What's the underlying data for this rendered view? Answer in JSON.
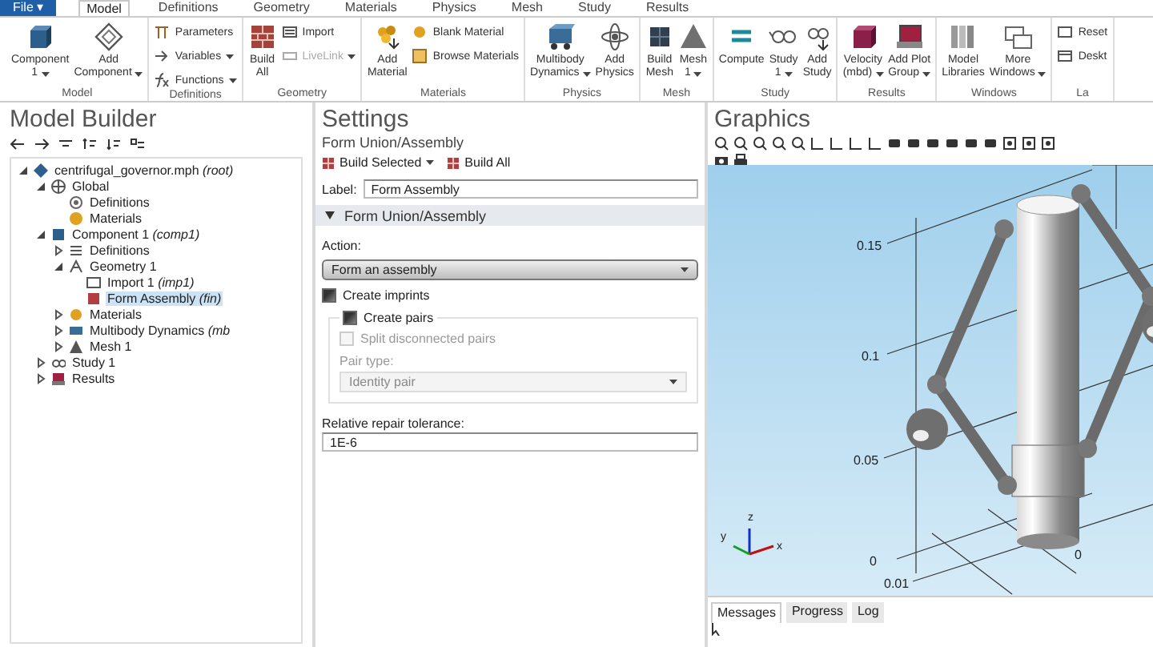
{
  "menu_tabs": [
    {
      "label": "File ▾",
      "kind": "file",
      "selected": false
    },
    {
      "label": "Model",
      "kind": "tab",
      "selected": true
    },
    {
      "label": "Definitions",
      "kind": "tab",
      "selected": false
    },
    {
      "label": "Geometry",
      "kind": "tab",
      "selected": false
    },
    {
      "label": "Materials",
      "kind": "tab",
      "selected": false
    },
    {
      "label": "Physics",
      "kind": "tab",
      "selected": false
    },
    {
      "label": "Mesh",
      "kind": "tab",
      "selected": false
    },
    {
      "label": "Study",
      "kind": "tab",
      "selected": false
    },
    {
      "label": "Results",
      "kind": "tab",
      "selected": false
    }
  ],
  "ribbon": {
    "groups": [
      {
        "label": "Model",
        "items": [
          {
            "kind": "large",
            "lines": [
              "Component",
              "1"
            ],
            "dropdown": true,
            "disabled": false
          },
          {
            "kind": "large",
            "lines": [
              "Add",
              "Component"
            ],
            "dropdown": true,
            "disabled": false
          }
        ]
      },
      {
        "label": "Definitions",
        "items": [
          {
            "kind": "small",
            "lines": [
              "Parameters"
            ],
            "dropdown": false,
            "disabled": false
          },
          {
            "kind": "small",
            "lines": [
              "Variables"
            ],
            "dropdown": true,
            "disabled": false
          },
          {
            "kind": "small",
            "lines": [
              "Functions"
            ],
            "dropdown": true,
            "disabled": false
          }
        ]
      },
      {
        "label": "Geometry",
        "items": [
          {
            "kind": "large",
            "lines": [
              "Build",
              "All"
            ],
            "dropdown": false,
            "disabled": false
          },
          {
            "kind": "small",
            "lines": [
              "Import"
            ],
            "dropdown": false,
            "disabled": false
          },
          {
            "kind": "small",
            "lines": [
              "LiveLink"
            ],
            "dropdown": true,
            "disabled": true
          }
        ]
      },
      {
        "label": "Materials",
        "items": [
          {
            "kind": "large",
            "lines": [
              "Add",
              "Material"
            ],
            "dropdown": false,
            "disabled": false
          },
          {
            "kind": "small",
            "lines": [
              "Blank Material"
            ],
            "dropdown": false,
            "disabled": false
          },
          {
            "kind": "small",
            "lines": [
              "Browse Materials"
            ],
            "dropdown": false,
            "disabled": false
          }
        ]
      },
      {
        "label": "Physics",
        "items": [
          {
            "kind": "large",
            "lines": [
              "Multibody",
              "Dynamics"
            ],
            "dropdown": true,
            "disabled": false
          },
          {
            "kind": "large",
            "lines": [
              "Add",
              "Physics"
            ],
            "dropdown": false,
            "disabled": false
          }
        ]
      },
      {
        "label": "Mesh",
        "items": [
          {
            "kind": "large",
            "lines": [
              "Build",
              "Mesh"
            ],
            "dropdown": false,
            "disabled": false
          },
          {
            "kind": "large",
            "lines": [
              "Mesh",
              "1"
            ],
            "dropdown": true,
            "disabled": false
          }
        ]
      },
      {
        "label": "Study",
        "items": [
          {
            "kind": "large",
            "lines": [
              "Compute"
            ],
            "dropdown": false,
            "disabled": false
          },
          {
            "kind": "large",
            "lines": [
              "Study",
              "1"
            ],
            "dropdown": true,
            "disabled": false
          },
          {
            "kind": "large",
            "lines": [
              "Add",
              "Study"
            ],
            "dropdown": false,
            "disabled": false
          }
        ]
      },
      {
        "label": "Results",
        "items": [
          {
            "kind": "large",
            "lines": [
              "Velocity",
              "(mbd)"
            ],
            "dropdown": true,
            "disabled": false
          },
          {
            "kind": "large",
            "lines": [
              "Add Plot",
              "Group"
            ],
            "dropdown": true,
            "disabled": false
          }
        ]
      },
      {
        "label": "Windows",
        "items": [
          {
            "kind": "large",
            "lines": [
              "Model",
              "Libraries"
            ],
            "dropdown": false,
            "disabled": false
          },
          {
            "kind": "large",
            "lines": [
              "More",
              "Windows"
            ],
            "dropdown": true,
            "disabled": false
          }
        ]
      },
      {
        "label": "La",
        "items": [
          {
            "kind": "small",
            "lines": [
              "Reset"
            ],
            "dropdown": false,
            "disabled": false
          },
          {
            "kind": "small",
            "lines": [
              "Deskt"
            ],
            "dropdown": false,
            "disabled": false
          }
        ]
      }
    ]
  },
  "model_builder": {
    "title": "Model Builder",
    "tree": [
      {
        "label": "centrifugal_governor.mph *(root)*",
        "expanded": true,
        "selected": false,
        "children": [
          {
            "label": "Global",
            "expanded": true,
            "selected": false,
            "children": [
              {
                "label": "Definitions",
                "selected": false
              },
              {
                "label": "Materials",
                "selected": false
              }
            ]
          },
          {
            "label": "Component 1 *(comp1)*",
            "expanded": true,
            "selected": false,
            "children": [
              {
                "label": "Definitions",
                "expanded": false,
                "selected": false
              },
              {
                "label": "Geometry 1",
                "expanded": true,
                "selected": false,
                "children": [
                  {
                    "label": "Import 1 *(imp1)*",
                    "selected": false
                  },
                  {
                    "label": "Form Assembly *(fin)*",
                    "selected": true
                  }
                ]
              },
              {
                "label": "Materials",
                "expanded": false,
                "selected": false
              },
              {
                "label": "Multibody Dynamics *(mb*",
                "expanded": false,
                "selected": false
              },
              {
                "label": "Mesh 1",
                "expanded": false,
                "selected": false
              }
            ]
          },
          {
            "label": "Study 1",
            "expanded": false,
            "selected": false
          },
          {
            "label": "Results",
            "expanded": false,
            "selected": false
          }
        ]
      }
    ]
  },
  "settings": {
    "title": "Settings",
    "subtitle": "Form Union/Assembly",
    "toolbar": [
      {
        "label": "Build Selected",
        "dropdown": true
      },
      {
        "label": "Build All",
        "dropdown": false
      }
    ],
    "label_field": {
      "label": "Label:",
      "value": "Form Assembly"
    },
    "section": {
      "title": "Form Union/Assembly",
      "expanded": true
    },
    "action": {
      "label": "Action:",
      "value": "Form an assembly"
    },
    "create_imprints": {
      "label": "Create imprints",
      "checked": true
    },
    "create_pairs": {
      "label": "Create pairs",
      "checked": true
    },
    "split_pairs": {
      "label": "Split disconnected pairs",
      "checked": false,
      "disabled": true
    },
    "pair_type": {
      "label": "Pair type:",
      "value": "Identity pair",
      "disabled": true
    },
    "tolerance": {
      "label": "Relative repair tolerance:",
      "value": "1E-6"
    }
  },
  "graphics": {
    "title": "Graphics",
    "axis_labels": [
      "0.15",
      "0.1",
      "0.05",
      "0",
      "0.01",
      "0"
    ],
    "triad_labels": [
      "z",
      "y",
      "x"
    ]
  },
  "messages": {
    "tabs": [
      {
        "label": "Messages",
        "selected": true
      },
      {
        "label": "Progress",
        "selected": false
      },
      {
        "label": "Log",
        "selected": false
      }
    ]
  }
}
